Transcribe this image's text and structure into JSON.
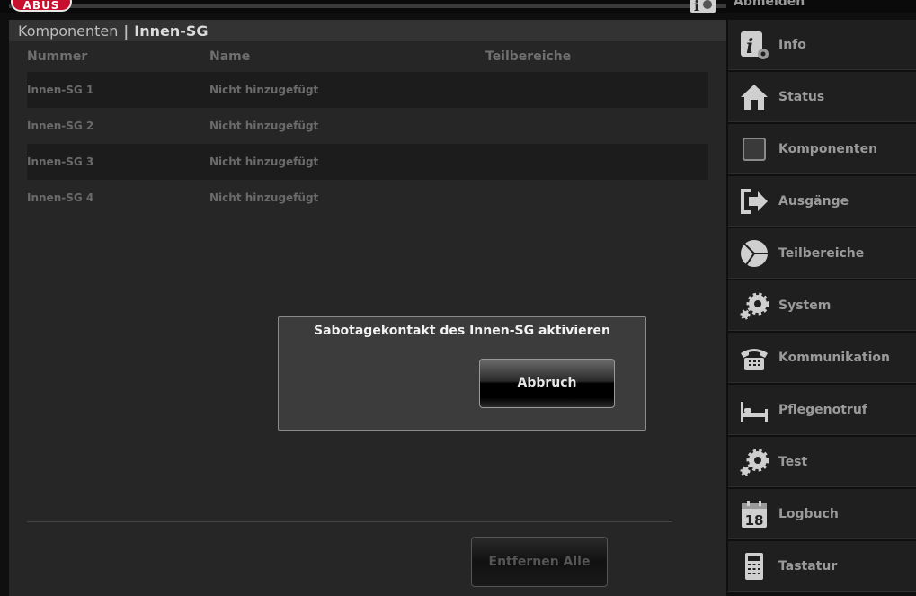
{
  "header": {
    "logo_text": "ABUS",
    "logout_label": "Abmelden"
  },
  "breadcrumb": {
    "parent": "Komponenten",
    "separator": "|",
    "current": "Innen-SG"
  },
  "table": {
    "columns": [
      "Nummer",
      "Name",
      "Teilbereiche"
    ],
    "rows": [
      {
        "number": "Innen-SG 1",
        "name": "Nicht hinzugefügt",
        "areas": ""
      },
      {
        "number": "Innen-SG 2",
        "name": "Nicht hinzugefügt",
        "areas": ""
      },
      {
        "number": "Innen-SG 3",
        "name": "Nicht hinzugefügt",
        "areas": ""
      },
      {
        "number": "Innen-SG 4",
        "name": "Nicht hinzugefügt",
        "areas": ""
      }
    ]
  },
  "footer": {
    "remove_all_label": "Entfernen Alle"
  },
  "modal": {
    "title": "Sabotagekontakt des Innen-SG aktivieren",
    "cancel_label": "Abbruch"
  },
  "sidebar": {
    "items": [
      {
        "label": "Info",
        "icon": "info-icon"
      },
      {
        "label": "Status",
        "icon": "house-icon"
      },
      {
        "label": "Komponenten",
        "icon": "square-icon"
      },
      {
        "label": "Ausgänge",
        "icon": "exit-arrow-icon"
      },
      {
        "label": "Teilbereiche",
        "icon": "pie-icon"
      },
      {
        "label": "System",
        "icon": "gears-icon"
      },
      {
        "label": "Kommunikation",
        "icon": "telephone-icon"
      },
      {
        "label": "Pflegenotruf",
        "icon": "bed-icon"
      },
      {
        "label": "Test",
        "icon": "gears-icon"
      },
      {
        "label": "Logbuch",
        "icon": "calendar-icon",
        "calendar_day": "18"
      },
      {
        "label": "Tastatur",
        "icon": "keypad-icon"
      }
    ]
  },
  "colors": {
    "brand": "#c8102e",
    "background": "#262626",
    "sidebar": "#1f1f1f",
    "modal": "#3c3c3c"
  }
}
